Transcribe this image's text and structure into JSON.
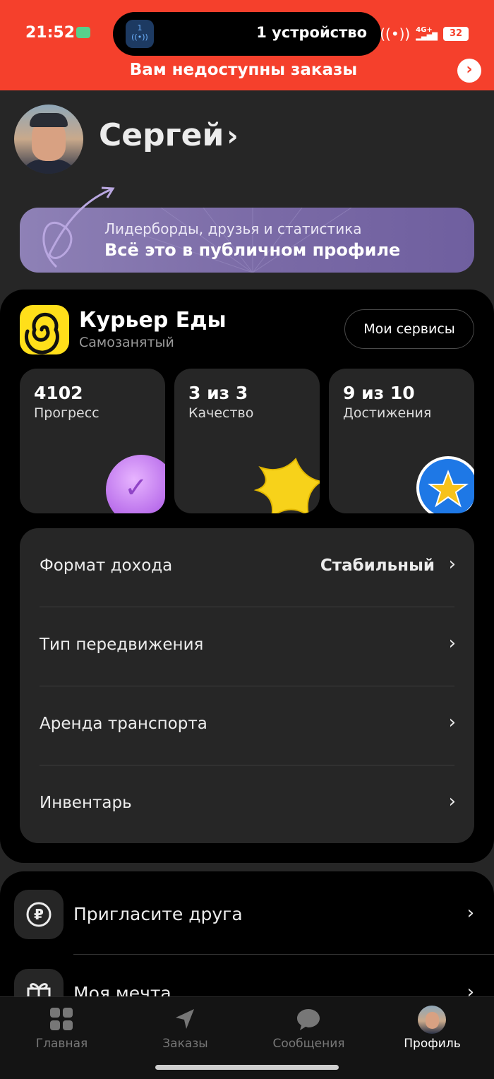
{
  "status_bar": {
    "time": "21:52",
    "island_count": "1",
    "island_text": "1 устройство",
    "network": "4G+",
    "battery": "32"
  },
  "banner": {
    "text": "Вам недоступны заказы",
    "chevron": "›"
  },
  "profile": {
    "name": "Сергей",
    "chevron": "›"
  },
  "promo": {
    "line1": "Лидерборды, друзья и статистика",
    "line2": "Всё это в публичном профиле"
  },
  "service": {
    "title": "Курьер Еды",
    "subtitle": "Самозанятый",
    "button": "Мои сервисы",
    "logo_color": "#ffdf1a"
  },
  "stats": [
    {
      "value": "4102",
      "label": "Прогресс",
      "badge": "purple-check-coin-icon"
    },
    {
      "value": "3 из 3",
      "label": "Качество",
      "badge": "yellow-star-icon"
    },
    {
      "value": "9 из 10",
      "label": "Достижения",
      "badge": "blue-star-hand-icon"
    }
  ],
  "settings": [
    {
      "label": "Формат дохода",
      "value": "Стабильный",
      "chevron": "›"
    },
    {
      "label": "Тип передвижения",
      "value": "",
      "chevron": "›"
    },
    {
      "label": "Аренда транспорта",
      "value": "",
      "chevron": "›"
    },
    {
      "label": "Инвентарь",
      "value": "",
      "chevron": "›"
    }
  ],
  "extras": [
    {
      "label": "Пригласите друга",
      "icon": "ruble-coin-icon",
      "chevron": "›"
    },
    {
      "label": "Моя мечта",
      "icon": "gift-icon",
      "chevron": "›"
    }
  ],
  "nav": [
    {
      "label": "Главная",
      "icon": "grid-icon",
      "active": false
    },
    {
      "label": "Заказы",
      "icon": "navigation-arrow-icon",
      "active": false
    },
    {
      "label": "Сообщения",
      "icon": "chat-bubble-icon",
      "active": false
    },
    {
      "label": "Профиль",
      "icon": "avatar",
      "active": true
    }
  ],
  "colors": {
    "banner_red": "#f5402c",
    "background": "#262626",
    "card": "#000000",
    "promo_purple": "#7a6aa6"
  }
}
